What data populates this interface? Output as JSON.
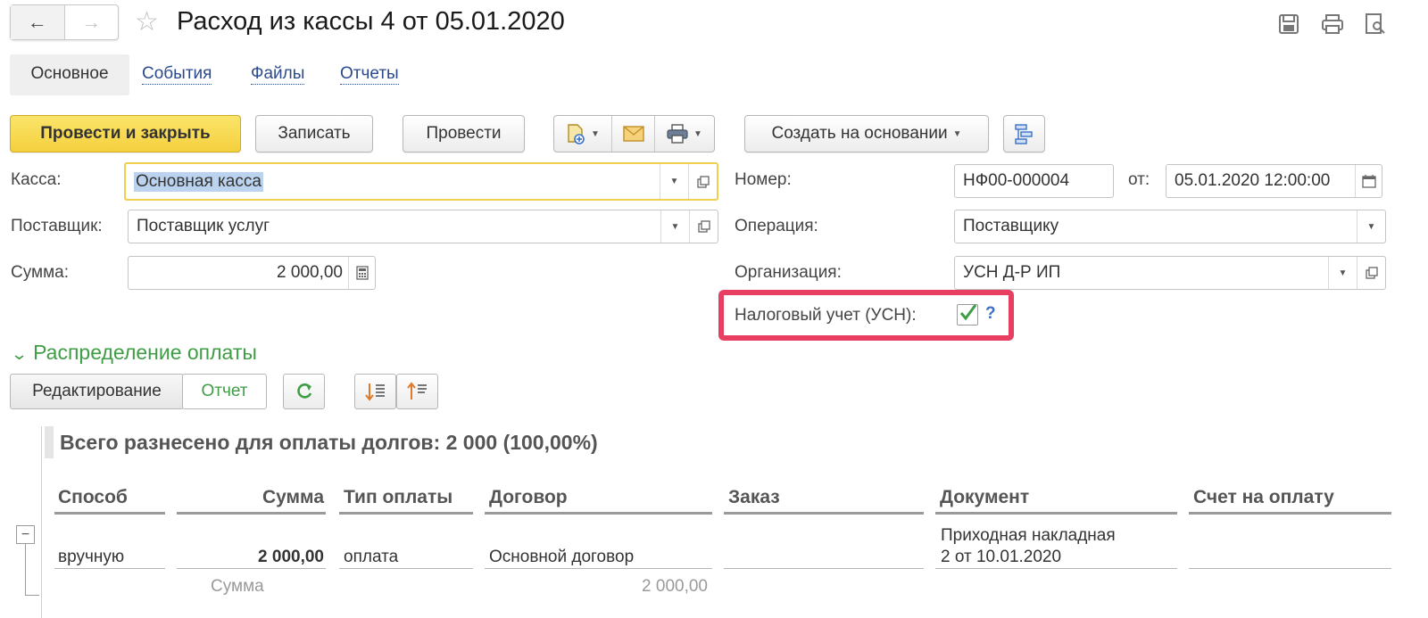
{
  "header": {
    "title": "Расход из кассы 4 от 05.01.2020",
    "back_icon": "arrow-left",
    "forward_icon": "arrow-right",
    "favorite_icon": "star"
  },
  "tabs": [
    {
      "label": "Основное",
      "active": true
    },
    {
      "label": "События",
      "active": false
    },
    {
      "label": "Файлы",
      "active": false
    },
    {
      "label": "Отчеты",
      "active": false
    }
  ],
  "toolbar": {
    "post_and_close": "Провести и закрыть",
    "save": "Записать",
    "post": "Провести",
    "create_based_on": "Создать на основании"
  },
  "form": {
    "kassa_label": "Касса:",
    "kassa_value": "Основная касса",
    "supplier_label": "Поставщик:",
    "supplier_value": "Поставщик услуг",
    "sum_label": "Сумма:",
    "sum_value": "2 000,00",
    "number_label": "Номер:",
    "number_value": "НФ00-000004",
    "date_label": "от:",
    "date_value": "05.01.2020 12:00:00",
    "operation_label": "Операция:",
    "operation_value": "Поставщику",
    "organization_label": "Организация:",
    "organization_value": "УСН Д-Р ИП",
    "tax_label": "Налоговый учет (УСН):",
    "tax_checked": true,
    "help": "?"
  },
  "section": {
    "title": "Распределение оплаты",
    "edit_button": "Редактирование",
    "report_button": "Отчет"
  },
  "report": {
    "title": "Всего разнесено для оплаты долгов: 2 000 (100,00%)",
    "columns": [
      "Способ",
      "Сумма",
      "Тип оплаты",
      "Договор",
      "Заказ",
      "Документ",
      "Счет на оплату"
    ],
    "row": {
      "method": "вручную",
      "sum": "2 000,00",
      "payment_type": "оплата",
      "contract": "Основной договор",
      "order": "",
      "document_line1": "Приходная накладная",
      "document_line2": "2 от 10.01.2020",
      "invoice": ""
    },
    "total_label": "Сумма",
    "total_value": "2 000,00"
  },
  "colors": {
    "primary_button": "#f4d03d",
    "highlight_border": "#e83e62",
    "section_green": "#3f9d45",
    "link_blue": "#2b4a8e"
  }
}
